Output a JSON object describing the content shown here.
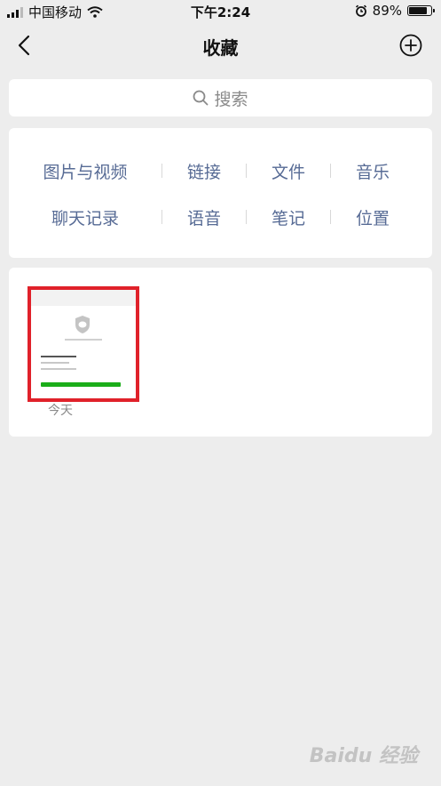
{
  "status_bar": {
    "carrier": "中国移动",
    "time": "下午2:24",
    "battery_text": "89%",
    "battery_level": 0.89
  },
  "nav": {
    "title": "收藏",
    "back_icon": "chevron-left-icon",
    "add_icon": "plus-circle-icon"
  },
  "search": {
    "label": "搜索",
    "icon": "search-icon"
  },
  "categories": {
    "row1": [
      "图片与视频",
      "链接",
      "文件",
      "音乐"
    ],
    "row2": [
      "聊天记录",
      "语音",
      "笔记",
      "位置"
    ]
  },
  "items": [
    {
      "date": "今天",
      "selected": true
    }
  ],
  "colors": {
    "link": "#576b95",
    "highlight": "#e0212a",
    "background": "#ededed"
  },
  "watermark": "Baidu 经验"
}
